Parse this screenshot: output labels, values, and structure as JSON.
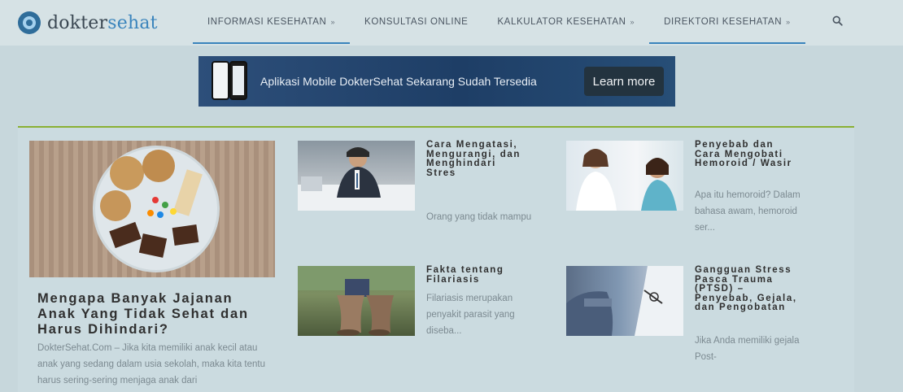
{
  "brand": {
    "name_part1": "dokter",
    "name_part2": "sehat"
  },
  "nav": {
    "items": [
      {
        "label": "INFORMASI KESEHATAN",
        "has_dropdown": true
      },
      {
        "label": "KONSULTASI ONLINE",
        "has_dropdown": false
      },
      {
        "label": "KALKULATOR KESEHATAN",
        "has_dropdown": true
      },
      {
        "label": "DIREKTORI KESEHATAN",
        "has_dropdown": true
      }
    ],
    "dropdown_glyph": "»",
    "search_icon": "search-icon"
  },
  "banner": {
    "text": "Aplikasi Mobile DokterSehat Sekarang Sudah Tersedia",
    "button_label": "Learn more"
  },
  "featured": {
    "title": "Mengapa Banyak Jajanan Anak Yang Tidak Sehat dan Harus Dihindari?",
    "excerpt": "DokterSehat.Com – Jika kita memiliki anak kecil atau anak yang sedang dalam usia sekolah, maka kita tentu harus sering-sering menjaga anak dari"
  },
  "articles": [
    {
      "title": "Cara Mengatasi, Mengurangi, dan Menghindari Stres",
      "excerpt": "Orang yang tidak mampu"
    },
    {
      "title": "Penyebab dan Cara Mengobati Hemoroid / Wasir",
      "excerpt": "Apa itu hemoroid? Dalam bahasa awam, hemoroid ser..."
    },
    {
      "title": "Fakta tentang Filariasis",
      "excerpt": "Filariasis merupakan penyakit parasit yang diseba..."
    },
    {
      "title": "Gangguan Stress Pasca Trauma (PTSD) – Penyebab, Gejala, dan Pengobatan",
      "excerpt": "Jika Anda memiliki gejala Post-"
    }
  ],
  "colors": {
    "accent": "#3a84bc",
    "green_rule": "#8ab034",
    "banner_bg": "#1e3e66",
    "page_bg": "#c7d7dc"
  }
}
